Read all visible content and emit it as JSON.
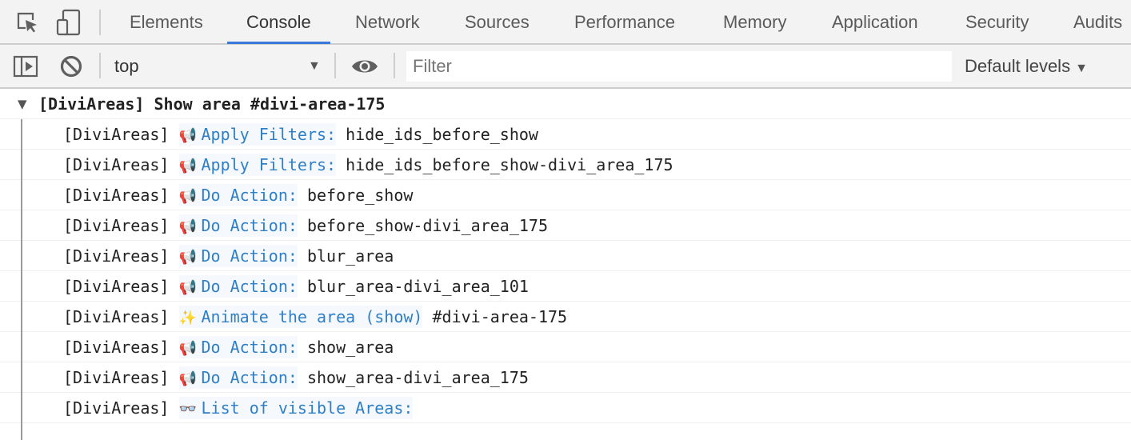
{
  "tabbar": {
    "tabs": [
      {
        "label": "Elements",
        "active": false
      },
      {
        "label": "Console",
        "active": true
      },
      {
        "label": "Network",
        "active": false
      },
      {
        "label": "Sources",
        "active": false
      },
      {
        "label": "Performance",
        "active": false
      },
      {
        "label": "Memory",
        "active": false
      },
      {
        "label": "Application",
        "active": false
      },
      {
        "label": "Security",
        "active": false
      },
      {
        "label": "Audits",
        "active": false
      }
    ],
    "icons": [
      "inspect-element-icon",
      "device-toolbar-icon"
    ]
  },
  "toolbar": {
    "context": "top",
    "filter_placeholder": "Filter",
    "levels_label": "Default levels",
    "accent": "#3879d9"
  },
  "console": {
    "group": {
      "title": "[DiviAreas] Show area #divi-area-175",
      "expanded": true
    },
    "messages": [
      {
        "prefix": "[DiviAreas]",
        "emoji": "📢",
        "label": "Apply Filters:",
        "value": "hide_ids_before_show"
      },
      {
        "prefix": "[DiviAreas]",
        "emoji": "📢",
        "label": "Apply Filters:",
        "value": "hide_ids_before_show-divi_area_175"
      },
      {
        "prefix": "[DiviAreas]",
        "emoji": "📢",
        "label": "Do Action:",
        "value": "before_show"
      },
      {
        "prefix": "[DiviAreas]",
        "emoji": "📢",
        "label": "Do Action:",
        "value": "before_show-divi_area_175"
      },
      {
        "prefix": "[DiviAreas]",
        "emoji": "📢",
        "label": "Do Action:",
        "value": "blur_area"
      },
      {
        "prefix": "[DiviAreas]",
        "emoji": "📢",
        "label": "Do Action:",
        "value": "blur_area-divi_area_101"
      },
      {
        "prefix": "[DiviAreas]",
        "emoji": "✨",
        "label": "Animate the area (show)",
        "value": "#divi-area-175"
      },
      {
        "prefix": "[DiviAreas]",
        "emoji": "📢",
        "label": "Do Action:",
        "value": "show_area"
      },
      {
        "prefix": "[DiviAreas]",
        "emoji": "📢",
        "label": "Do Action:",
        "value": "show_area-divi_area_175"
      },
      {
        "prefix": "[DiviAreas]",
        "emoji": "👓",
        "label": "List of visible Areas:",
        "value": ""
      }
    ],
    "label_color": "#2f7fc6"
  }
}
